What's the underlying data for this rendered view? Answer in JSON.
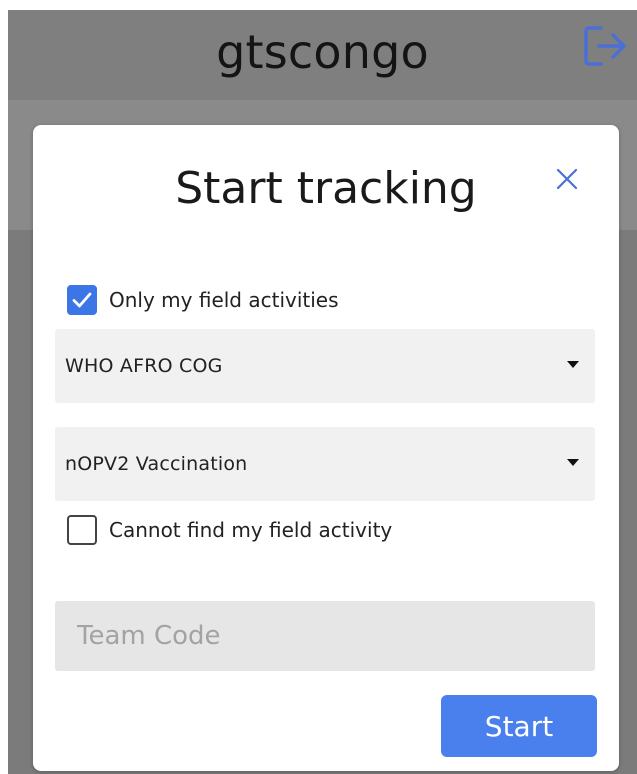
{
  "header": {
    "title": "gtscongo",
    "logout_icon": "logout-icon"
  },
  "modal": {
    "title": "Start tracking",
    "close_icon": "close-icon",
    "only_my_activities": {
      "label": "Only my field activities",
      "checked": true
    },
    "organization_select": {
      "selected": "WHO AFRO COG"
    },
    "activity_select": {
      "selected": "nOPV2 Vaccination"
    },
    "cannot_find_activity": {
      "label": "Cannot find my field activity",
      "checked": false
    },
    "team_code": {
      "value": "",
      "placeholder": "Team Code"
    },
    "start_button_label": "Start"
  },
  "colors": {
    "primary": "#4a7fee",
    "checkbox": "#3b75e6",
    "overlay": "#7b7b7b",
    "icon_blue": "#4a6fd6"
  }
}
